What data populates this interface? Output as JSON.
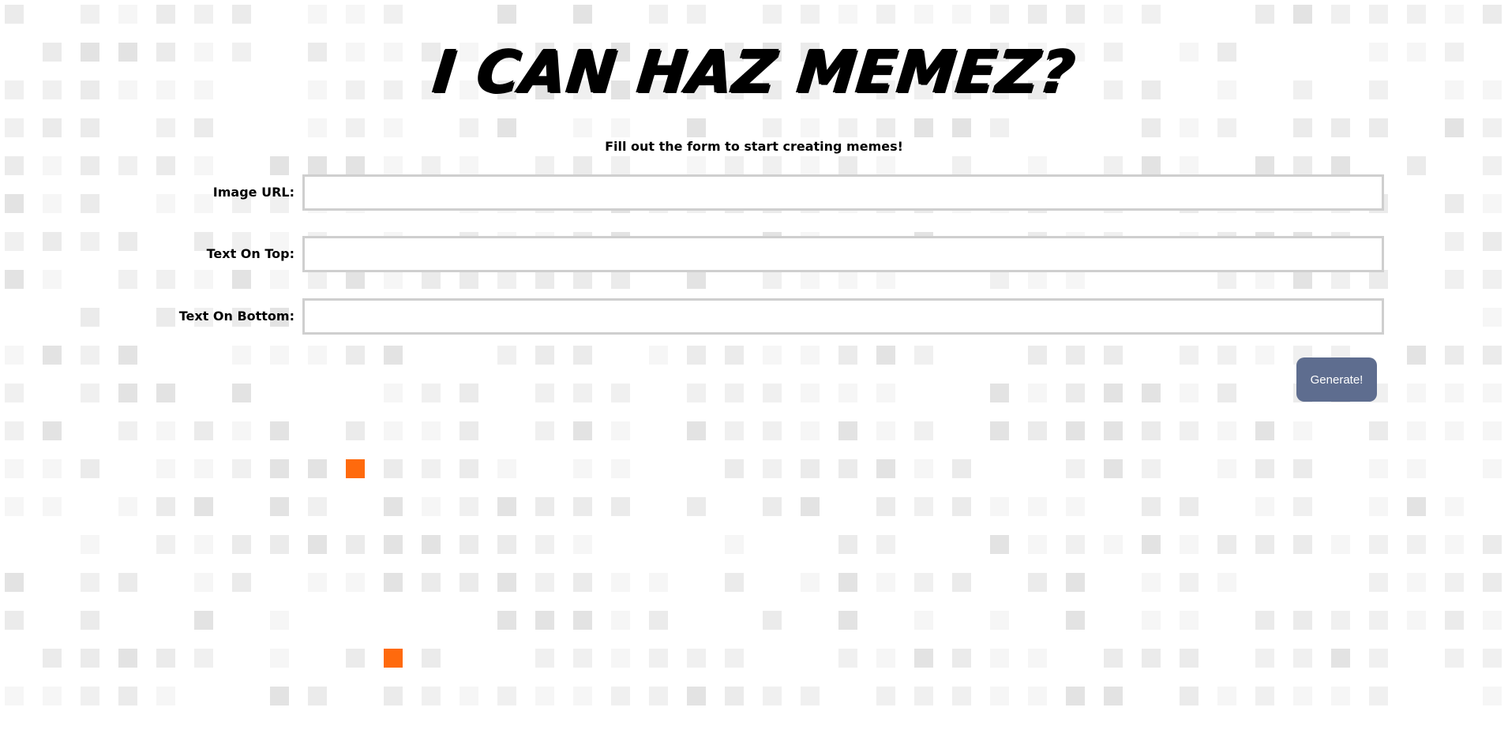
{
  "page": {
    "title": "I CAN HAZ MEMEZ?",
    "subtitle": "Fill out the form to start creating memes!"
  },
  "form": {
    "image_url": {
      "label": "Image URL:",
      "value": "",
      "placeholder": ""
    },
    "text_top": {
      "label": "Text On Top:",
      "value": "",
      "placeholder": ""
    },
    "text_bottom": {
      "label": "Text On Bottom:",
      "value": "",
      "placeholder": ""
    },
    "submit_label": "Generate!"
  },
  "colors": {
    "button_bg": "#5e6d8f",
    "button_text": "#ffffff",
    "input_border": "#cfcfcf",
    "highlight_tile": "#ff6a0d",
    "tile_shades": [
      "#f6f6f6",
      "#f0f0f0",
      "#ebebeb",
      "#e3e3e3"
    ]
  }
}
